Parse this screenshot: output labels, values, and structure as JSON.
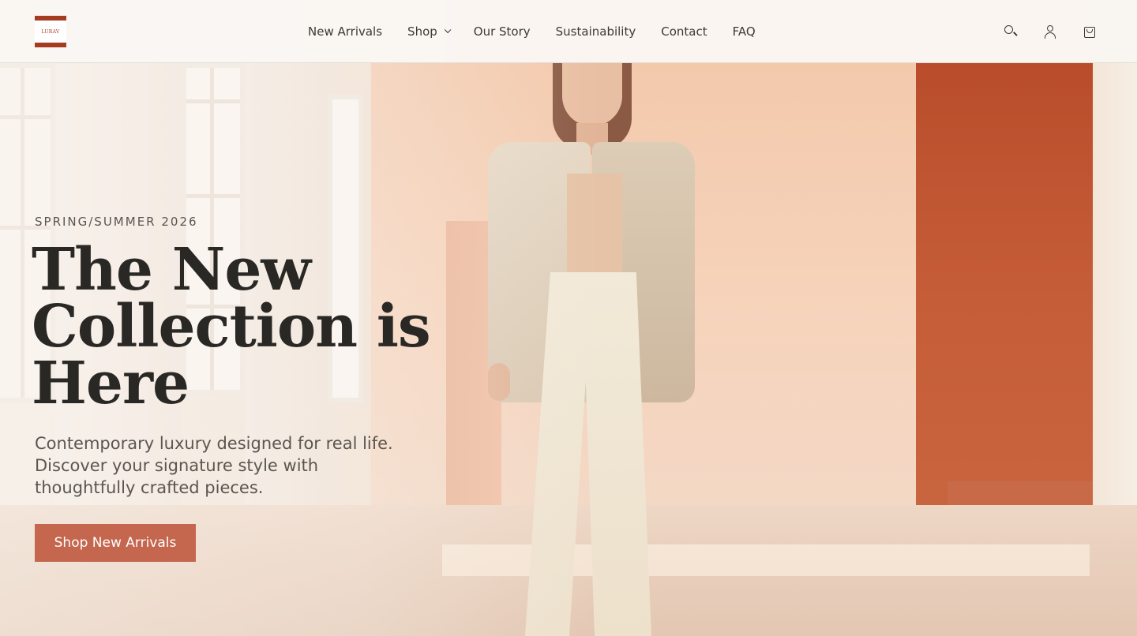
{
  "brand": {
    "logo_text": "LURAV",
    "accent": "#a53c22"
  },
  "nav": {
    "items": [
      {
        "label": "New Arrivals"
      },
      {
        "label": "Shop",
        "has_dropdown": true
      },
      {
        "label": "Our Story"
      },
      {
        "label": "Sustainability"
      },
      {
        "label": "Contact"
      },
      {
        "label": "FAQ"
      }
    ]
  },
  "header_icons": [
    "search-icon",
    "account-icon",
    "shopping-bag-icon"
  ],
  "hero": {
    "eyebrow": "SPRING/SUMMER 2026",
    "headline": "The New Collection is Here",
    "subtext": "Contemporary luxury designed for real life. Discover your signature style with thoughtfully crafted pieces.",
    "cta_label": "Shop New Arrivals",
    "cta_color": "#c4674e"
  }
}
